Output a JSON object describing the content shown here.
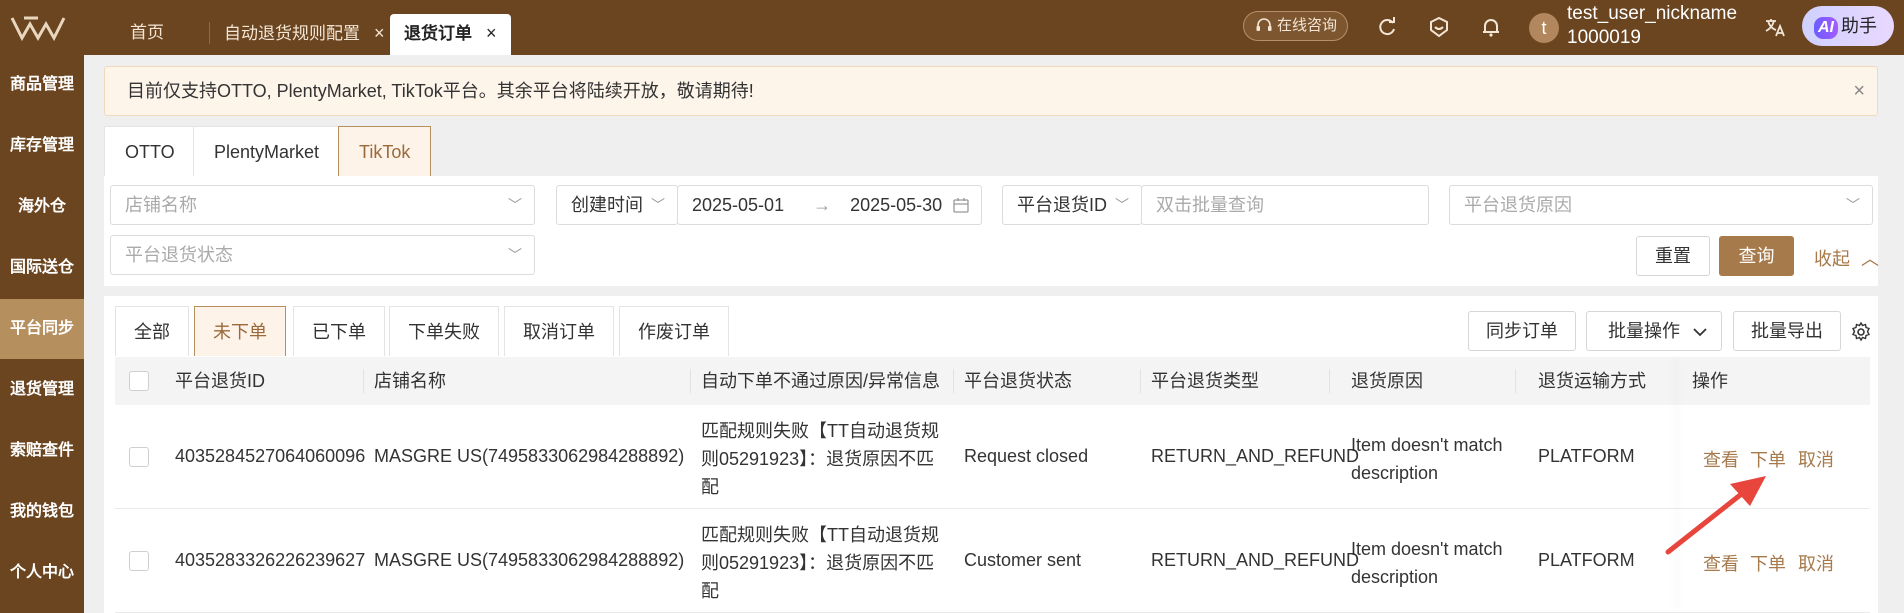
{
  "topbar": {
    "tabs": [
      {
        "label": "首页",
        "closable": false,
        "active": false
      },
      {
        "label": "自动退货规则配置",
        "closable": true,
        "active": false
      },
      {
        "label": "退货订单",
        "closable": true,
        "active": true
      }
    ],
    "close_glyph": "×",
    "consult_label": "在线咨询",
    "user_initial": "t",
    "username": "test_user_nickname",
    "user_id": "1000019",
    "ai_badge": "AI",
    "ai_label": "助手"
  },
  "sidebar": {
    "items": [
      {
        "label": "商品管理",
        "active": false
      },
      {
        "label": "库存管理",
        "active": false
      },
      {
        "label": "海外仓",
        "active": false
      },
      {
        "label": "国际送仓",
        "active": false
      },
      {
        "label": "平台同步",
        "active": true
      },
      {
        "label": "退货管理",
        "active": false
      },
      {
        "label": "索赔查件",
        "active": false
      },
      {
        "label": "我的钱包",
        "active": false
      },
      {
        "label": "个人中心",
        "active": false
      }
    ]
  },
  "notice": {
    "text": "目前仅支持OTTO, PlentyMarket, TikTok平台。其余平台将陆续开放，敬请期待!",
    "close_glyph": "×"
  },
  "platform_tabs": [
    {
      "label": "OTTO",
      "active": false
    },
    {
      "label": "PlentyMarket",
      "active": false
    },
    {
      "label": "TikTok",
      "active": true
    }
  ],
  "filters": {
    "store_placeholder": "店铺名称",
    "date_type": "创建时间",
    "date_start": "2025-05-01",
    "date_arrow": "→",
    "date_end": "2025-05-30",
    "id_type": "平台退货ID",
    "id_placeholder": "双击批量查询",
    "reason_placeholder": "平台退货原因",
    "status_placeholder": "平台退货状态",
    "reset_label": "重置",
    "search_label": "查询",
    "collapse_label": "收起"
  },
  "status_tabs": [
    {
      "label": "全部",
      "active": false
    },
    {
      "label": "未下单",
      "active": true
    },
    {
      "label": "已下单",
      "active": false
    },
    {
      "label": "下单失败",
      "active": false
    },
    {
      "label": "取消订单",
      "active": false
    },
    {
      "label": "作废订单",
      "active": false
    }
  ],
  "actions": {
    "sync_label": "同步订单",
    "batch_label": "批量操作",
    "export_label": "批量导出"
  },
  "table": {
    "columns": [
      "平台退货ID",
      "店铺名称",
      "自动下单不通过原因/异常信息",
      "平台退货状态",
      "平台退货类型",
      "退货原因",
      "退货运输方式",
      "操作"
    ],
    "rows": [
      {
        "id": "4035284527064060096",
        "store": "MASGRE US(7495833062984288892)",
        "reason_lines": [
          "匹配规则失败【TT自动退货规",
          "则05291923】：退货原因不匹",
          "配"
        ],
        "status": "Request closed",
        "type": "RETURN_AND_REFUND",
        "return_reason_lines": [
          "Item doesn't match",
          "description"
        ],
        "shipping": "PLATFORM",
        "ops": [
          "查看",
          "下单",
          "取消"
        ]
      },
      {
        "id": "4035283326226239627",
        "store": "MASGRE US(7495833062984288892)",
        "reason_lines": [
          "匹配规则失败【TT自动退货规",
          "则05291923】：退货原因不匹",
          "配"
        ],
        "status": "Customer sent",
        "type": "RETURN_AND_REFUND",
        "return_reason_lines": [
          "Item doesn't match",
          "description"
        ],
        "shipping": "PLATFORM",
        "ops": [
          "查看",
          "下单",
          "取消"
        ]
      }
    ]
  },
  "colors": {
    "brand_dark": "#6b4520",
    "accent": "#a77a4b",
    "sidebar_active": "#b58f5e",
    "annotation_arrow": "#e8453c"
  }
}
